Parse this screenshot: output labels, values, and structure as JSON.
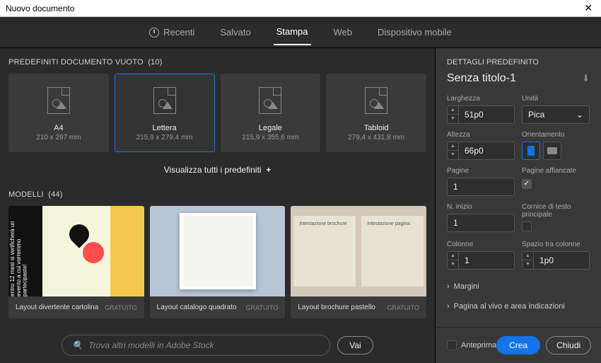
{
  "titlebar": {
    "title": "Nuovo documento"
  },
  "tabs": {
    "recent": "Recenti",
    "saved": "Salvato",
    "print": "Stampa",
    "web": "Web",
    "mobile": "Dispositivo mobile"
  },
  "presets_section": {
    "label": "PREDEFINITI DOCUMENTO VUOTO",
    "count": "(10)"
  },
  "presets": [
    {
      "name": "A4",
      "size": "210 x 297 mm"
    },
    {
      "name": "Lettera",
      "size": "215,9 x 279,4 mm"
    },
    {
      "name": "Legale",
      "size": "215,9 x 355,6 mm"
    },
    {
      "name": "Tabloid",
      "size": "279,4 x 431,8 mm"
    }
  ],
  "view_all": "Visualizza tutti i predefiniti",
  "models_section": {
    "label": "MODELLI",
    "count": "(44)"
  },
  "models": [
    {
      "name": "Layout divertente cartolina",
      "badge": "GRATUITO",
      "overlay": "entro 12 mesi\nsi verificherà\nun evento a\ncui vorremmo\npartecipaste!"
    },
    {
      "name": "Layout catalogo quadrato",
      "badge": "GRATUITO"
    },
    {
      "name": "Layout brochure pastello",
      "badge": "GRATUITO",
      "p1": "Intestazione brochure",
      "p2": "Intestazione pagina"
    }
  ],
  "search": {
    "placeholder": "Trova altri modelli in Adobe Stock",
    "go": "Vai"
  },
  "details": {
    "heading": "DETTAGLI PREDEFINITO",
    "doc_name": "Senza titolo-1",
    "width_label": "Larghezza",
    "width": "51p0",
    "unit_label": "Unità",
    "unit": "Pica",
    "height_label": "Altezza",
    "height": "66p0",
    "orient_label": "Orientamento",
    "pages_label": "Pagine",
    "pages": "1",
    "facing_label": "Pagine affiancate",
    "start_label": "N. inizio",
    "start": "1",
    "frame_label": "Cornice di testo principale",
    "cols_label": "Colonne",
    "cols": "1",
    "gutter_label": "Spazio tra colonne",
    "gutter": "1p0",
    "margins": "Margini",
    "bleed": "Pagina al vivo e area indicazioni"
  },
  "footer": {
    "preview": "Anteprima",
    "create": "Crea",
    "close": "Chiudi"
  }
}
